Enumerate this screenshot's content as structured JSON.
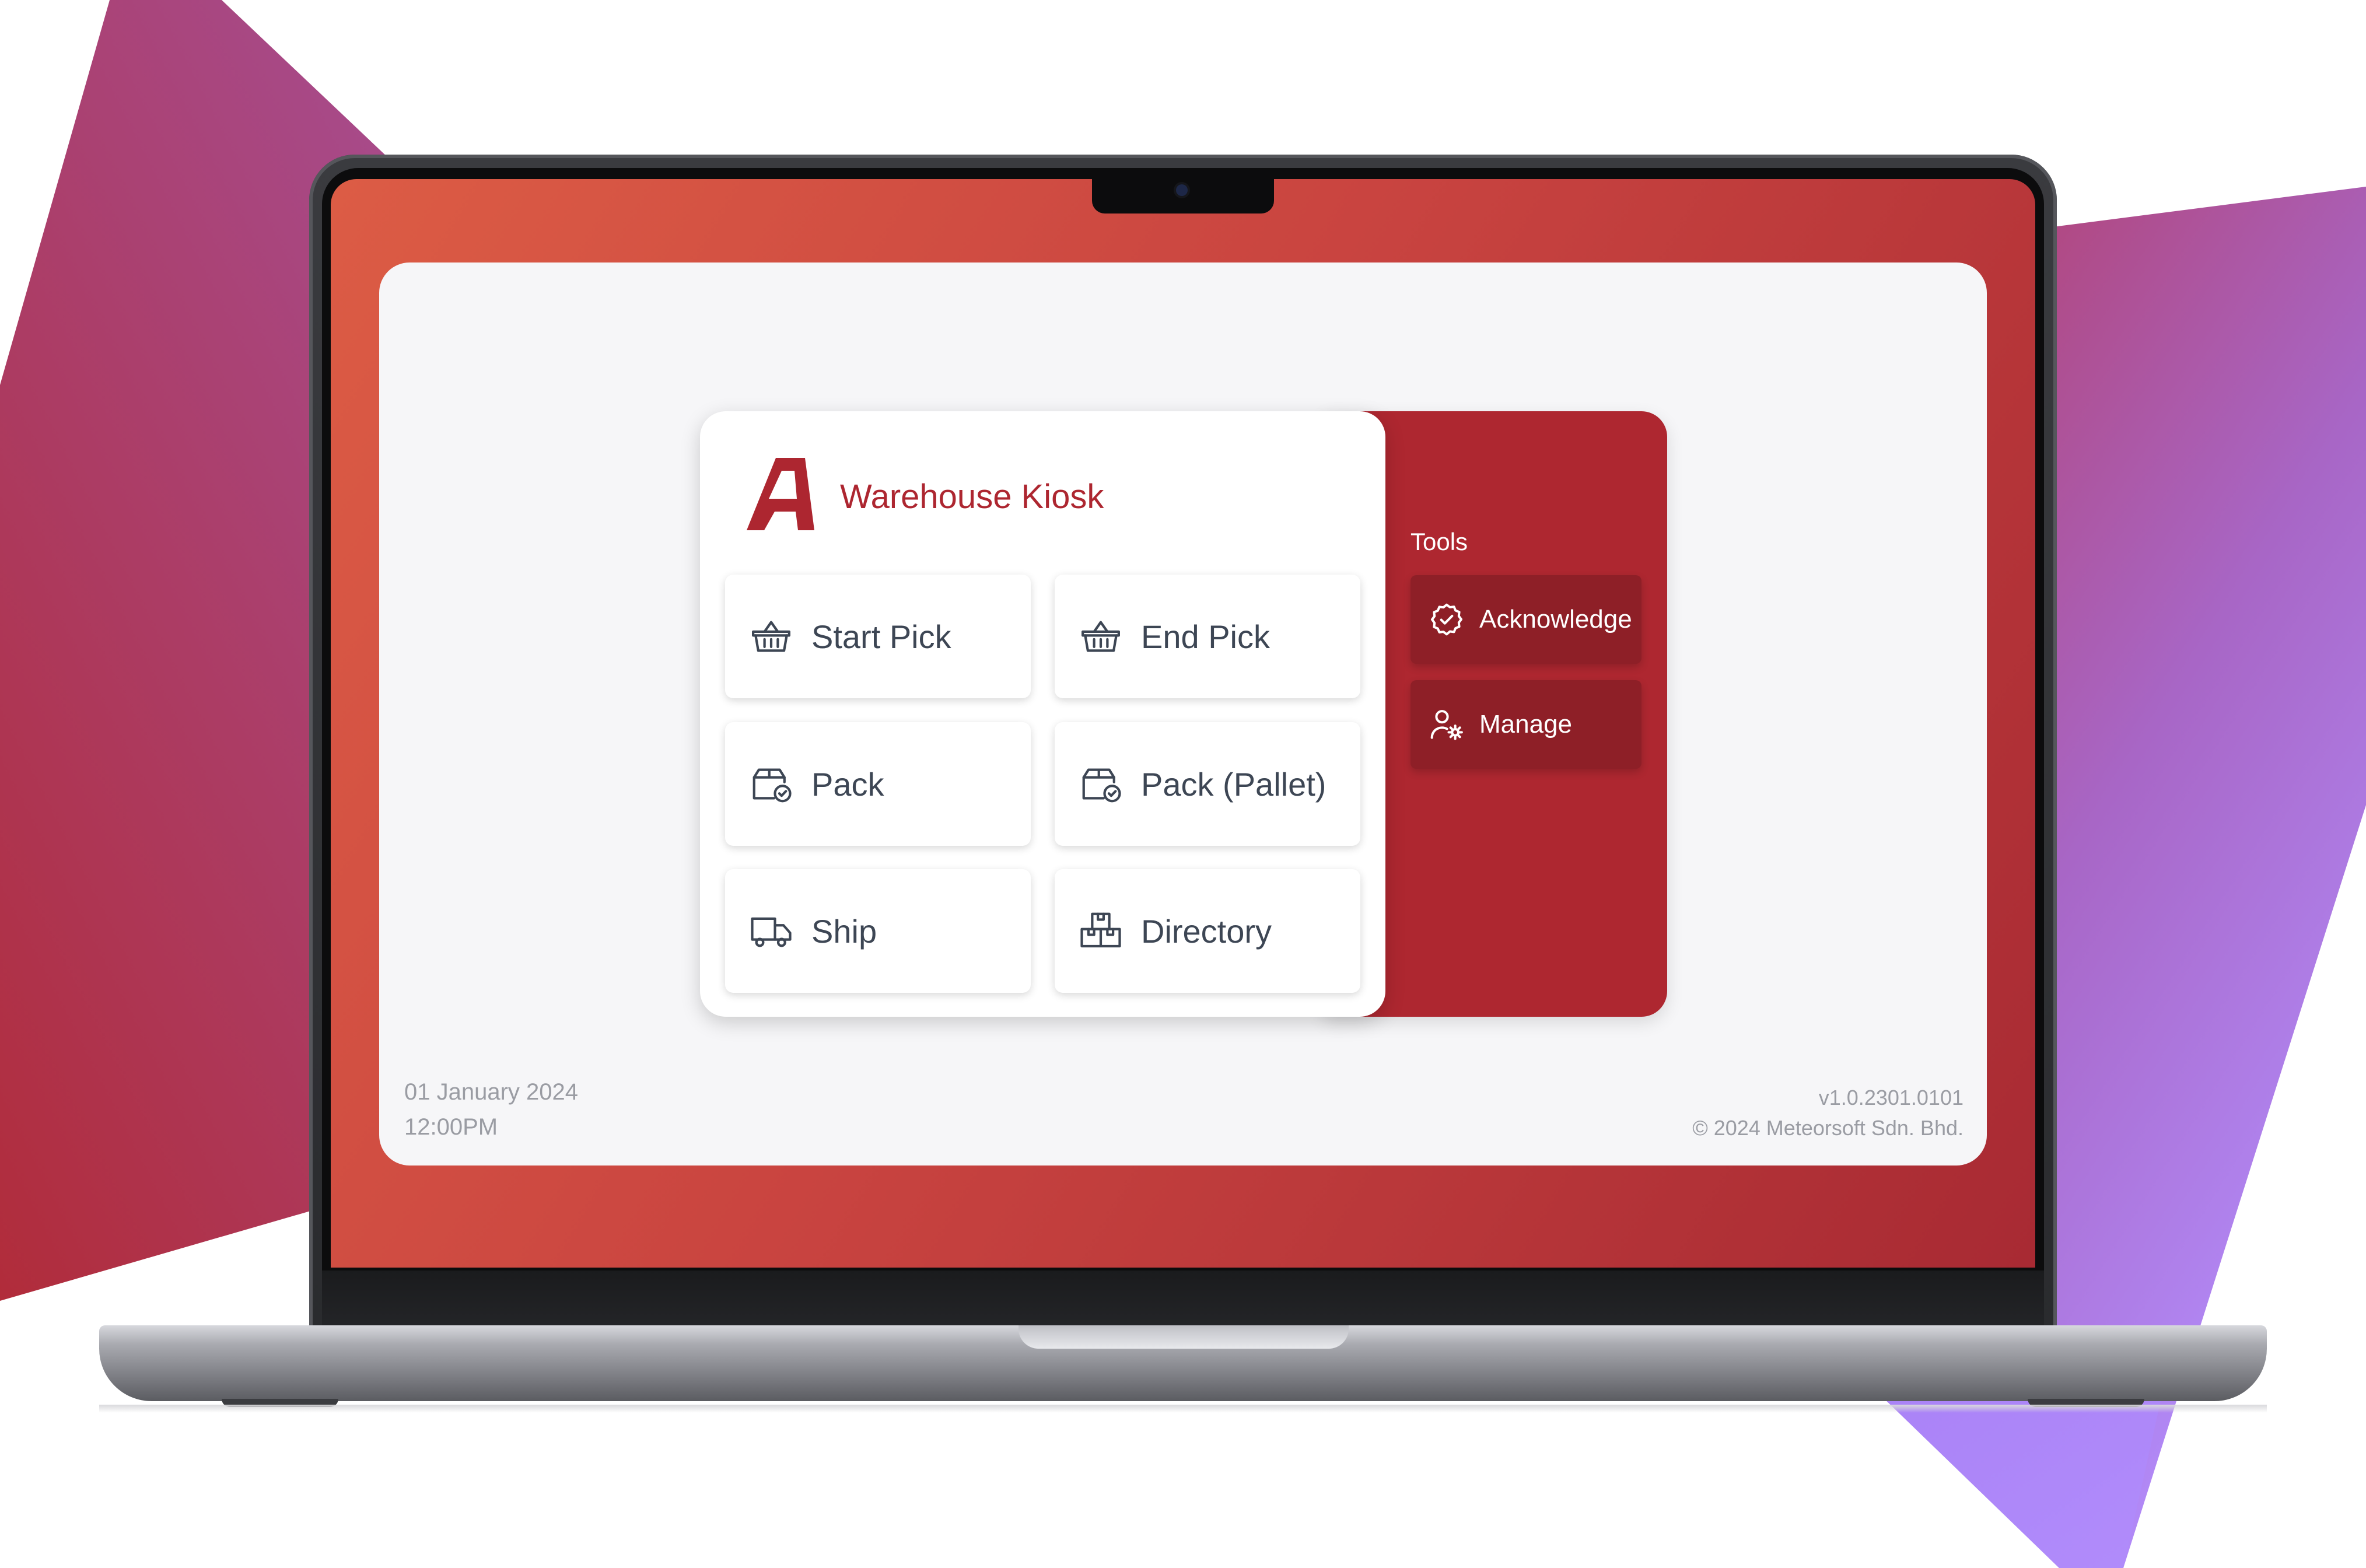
{
  "app": {
    "title": "Warehouse Kiosk",
    "logo_icon": "red-italic-A-logo",
    "brand_color": "#ad2630"
  },
  "actions": [
    {
      "label": "Start Pick",
      "icon": "basket-icon"
    },
    {
      "label": "End Pick",
      "icon": "basket-icon"
    },
    {
      "label": "Pack",
      "icon": "box-check-icon"
    },
    {
      "label": "Pack (Pallet)",
      "icon": "box-check-icon"
    },
    {
      "label": "Ship",
      "icon": "truck-icon"
    },
    {
      "label": "Directory",
      "icon": "boxes-icon"
    }
  ],
  "tools": {
    "title": "Tools",
    "items": [
      {
        "label": "Acknowledge",
        "icon": "badge-check-icon"
      },
      {
        "label": "Manage",
        "icon": "user-gear-icon"
      }
    ],
    "panel_color": "#ae2730",
    "button_color": "#8e1f27"
  },
  "footer": {
    "date": "01 January 2024",
    "time": "12:00PM",
    "version": "v1.0.2301.0101",
    "copyright": "© 2024 Meteorsoft Sdn. Bhd."
  }
}
